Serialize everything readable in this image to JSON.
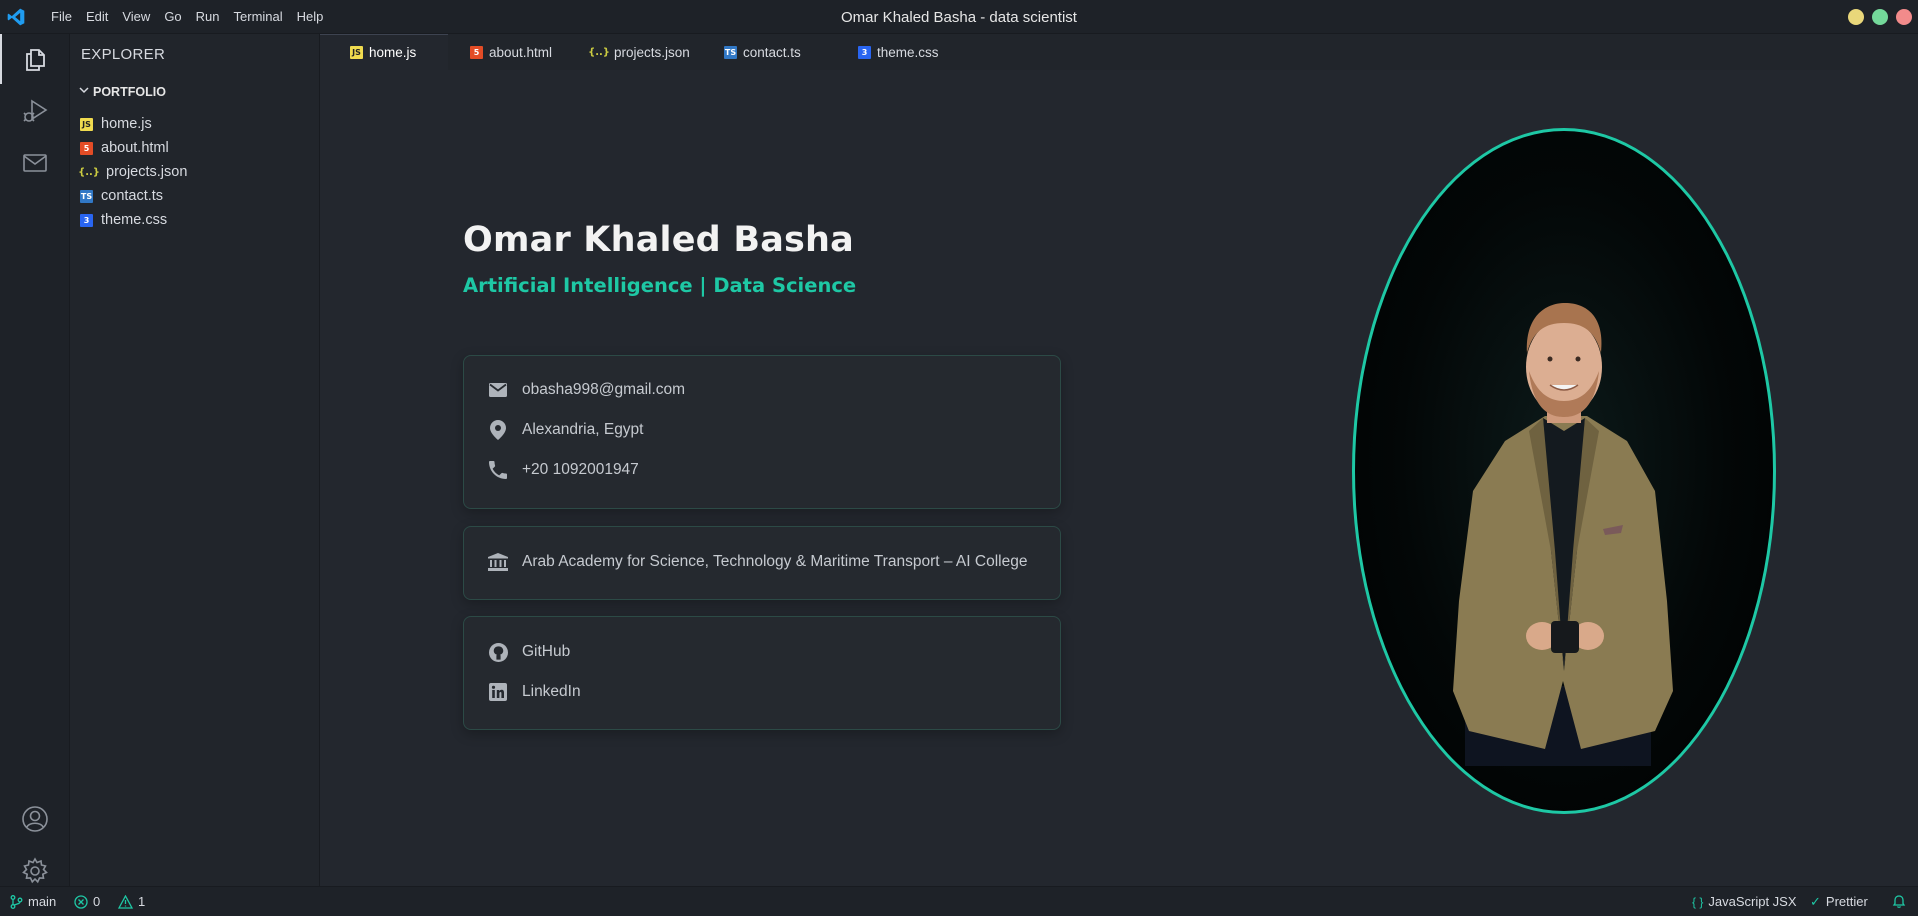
{
  "window": {
    "title": "Omar Khaled Basha - data scientist",
    "controls": [
      "#e9d77a",
      "#74d89a",
      "#f28b8b"
    ]
  },
  "menu": [
    "File",
    "Edit",
    "View",
    "Go",
    "Run",
    "Terminal",
    "Help"
  ],
  "activity_bar": {
    "top": [
      "files-icon",
      "run-debug-icon",
      "mail-icon"
    ],
    "bottom": [
      "account-icon",
      "settings-icon"
    ]
  },
  "sidebar": {
    "title": "EXPLORER",
    "folder": "PORTFOLIO",
    "files": [
      {
        "label": "home.js",
        "icon": "js-icon"
      },
      {
        "label": "about.html",
        "icon": "html-icon"
      },
      {
        "label": "projects.json",
        "icon": "json-icon"
      },
      {
        "label": "contact.ts",
        "icon": "ts-icon"
      },
      {
        "label": "theme.css",
        "icon": "css-icon"
      }
    ]
  },
  "tabs": [
    {
      "label": "home.js",
      "icon": "js-icon",
      "active": true
    },
    {
      "label": "about.html",
      "icon": "html-icon",
      "active": false
    },
    {
      "label": "projects.json",
      "icon": "json-icon",
      "active": false
    },
    {
      "label": "contact.ts",
      "icon": "ts-icon",
      "active": false
    },
    {
      "label": "theme.css",
      "icon": "css-icon",
      "active": false
    }
  ],
  "profile": {
    "name": "Omar Khaled Basha",
    "subtitle": "Artificial Intelligence | Data Science",
    "contact": {
      "email": "obasha998@gmail.com",
      "location": "Alexandria, Egypt",
      "phone": "+20 1092001947"
    },
    "education": "Arab Academy for Science, Technology & Maritime Transport – AI College",
    "links": {
      "github": "GitHub",
      "linkedin": "LinkedIn"
    }
  },
  "statusbar": {
    "branch": "main",
    "errors": "0",
    "warnings": "1",
    "language": "JavaScript JSX",
    "formatter": "Prettier"
  },
  "colors": {
    "accent": "#1ec8a5",
    "background": "#23272e",
    "sidebar": "#21252b",
    "js": "#f0db4f",
    "html": "#e34c26",
    "json": "#cbcb41",
    "ts": "#3178c6",
    "css": "#2965f1"
  }
}
